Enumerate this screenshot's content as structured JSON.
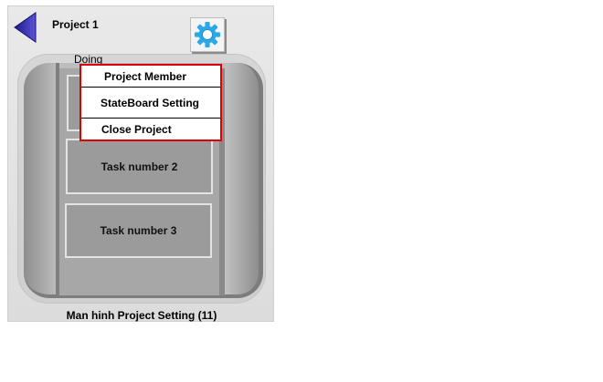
{
  "header": {
    "title": "Project 1",
    "back_icon": "back-arrow-icon",
    "settings_icon": "gear-icon"
  },
  "board": {
    "column_label": "Doing",
    "tasks": [
      {
        "label": ""
      },
      {
        "label": "Task number 2"
      },
      {
        "label": "Task number 3"
      }
    ]
  },
  "settings_menu": {
    "items": [
      {
        "label": "Project Member"
      },
      {
        "label": "StateBoard Setting"
      },
      {
        "label": "Close Project"
      }
    ],
    "border_color": "#e00000"
  },
  "caption": "Man hinh Project Setting (11)",
  "colors": {
    "back_arrow": "#3a32b8",
    "gear": "#2aa8e8",
    "menu_border": "#e00000"
  }
}
